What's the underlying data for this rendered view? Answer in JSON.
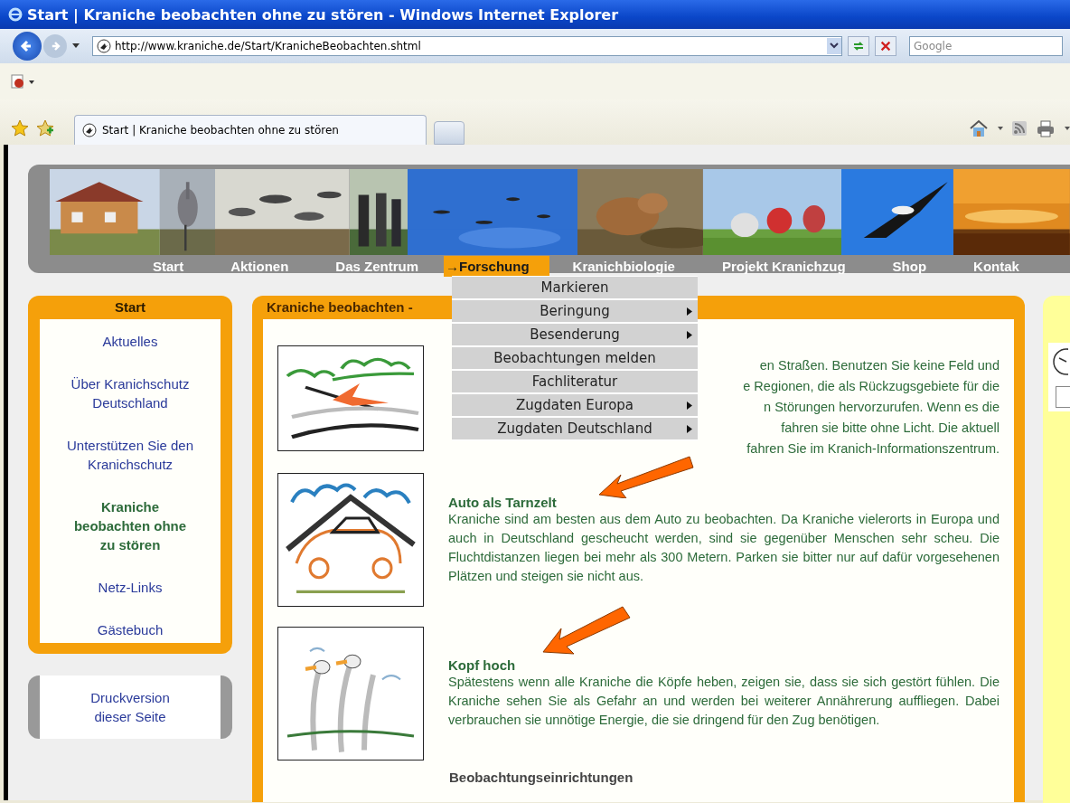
{
  "browser": {
    "title": "Start | Kraniche beobachten ohne zu stören - Windows Internet Explorer",
    "address": "http://www.kraniche.de/Start/KranicheBeobachten.shtml",
    "search_placeholder": "Google",
    "tab": "Start | Kraniche beobachten ohne zu stören"
  },
  "nav": [
    {
      "label": "Start",
      "selected": false
    },
    {
      "label": "Aktionen",
      "selected": false
    },
    {
      "label": "Das Zentrum",
      "selected": false
    },
    {
      "label": "→Forschung",
      "selected": true
    },
    {
      "label": "Kranichbiologie",
      "selected": false
    },
    {
      "label": "Projekt Kranichzug",
      "selected": false
    },
    {
      "label": "Shop",
      "selected": false
    },
    {
      "label": "Kontak",
      "selected": false
    }
  ],
  "dropdown": [
    {
      "label": "Markieren",
      "submenu": false
    },
    {
      "label": "Beringung",
      "submenu": true
    },
    {
      "label": "Besenderung",
      "submenu": true
    },
    {
      "label": "Beobachtungen melden",
      "submenu": false
    },
    {
      "label": "Fachliteratur",
      "submenu": false
    },
    {
      "label": "Zugdaten Europa",
      "submenu": true
    },
    {
      "label": "Zugdaten Deutschland",
      "submenu": true
    }
  ],
  "sidebar": {
    "title": "Start",
    "items": [
      {
        "label": "Aktuelles",
        "selected": false
      },
      {
        "label": "Über Kranichschutz Deutschland",
        "selected": false
      },
      {
        "label": "Unterstützen Sie den Kranichschutz",
        "selected": false
      },
      {
        "label": "Kraniche beobachten ohne zu stören",
        "selected": true
      },
      {
        "label": "Netz-Links",
        "selected": false
      },
      {
        "label": "Gästebuch",
        "selected": false
      }
    ]
  },
  "print_link": "Druckversion dieser Seite",
  "main": {
    "title": "Kraniche beobachten -",
    "sections": [
      {
        "lines": [
          "en Straßen. Benutzen Sie keine Feld und",
          "e Regionen, die als Rückzugsgebiete für die",
          "n Störungen hervorzurufen. Wenn es die",
          "fahren sie bitte ohne Licht. Die aktuell",
          "fahren Sie im Kranich-Informationszentrum."
        ]
      },
      {
        "heading": "Auto als Tarnzelt",
        "text": "Kraniche sind am besten aus dem Auto zu beobachten. Da Kraniche vielerorts in Europa und auch in Deutschland gescheucht werden, sind sie gegenüber Menschen sehr scheu. Die Fluchtdistanzen liegen bei mehr als 300 Metern. Parken sie bitter nur auf dafür vorgesehenen Plätzen und steigen sie nicht aus."
      },
      {
        "heading": "Kopf hoch",
        "text": "Spätestens wenn alle Kraniche die Köpfe heben, zeigen sie, dass sie sich gestört fühlen. Die Kraniche sehen Sie als Gefahr an und werden bei weiterer Annährerung auffliegen. Dabei verbrauchen sie unnötige Energie, die sie dringend für den Zug benötigen."
      }
    ],
    "next_heading": "Beobachtungseinrichtungen"
  }
}
